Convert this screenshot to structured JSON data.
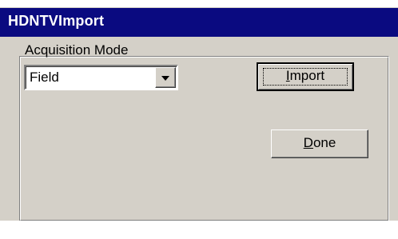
{
  "window": {
    "title": "HDNTVImport"
  },
  "form": {
    "acquisition_label": "Acquisition Mode",
    "acquisition_value": "Field"
  },
  "buttons": {
    "import_first": "I",
    "import_rest": "mport",
    "done_first": "D",
    "done_rest": "one"
  },
  "icons": {
    "dropdown": "chevron-down-icon"
  },
  "colors": {
    "titlebar": "#0a0a80",
    "face": "#d4d0c8"
  }
}
